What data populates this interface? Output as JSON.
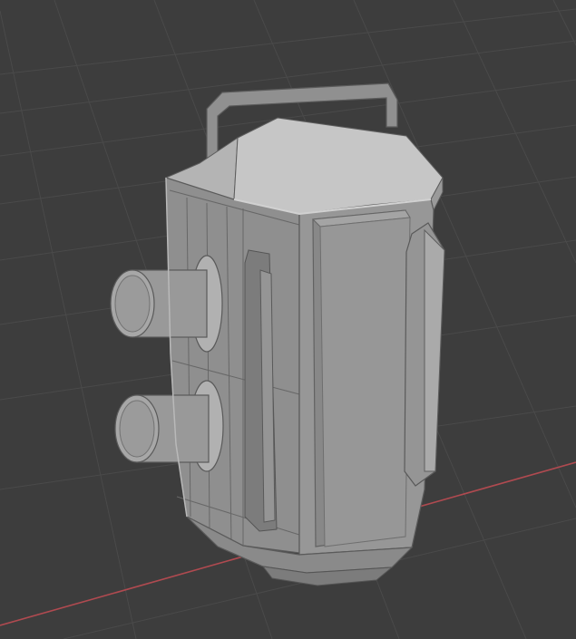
{
  "viewport": {
    "mode": "solid",
    "background_color": "#3d3d3d",
    "grid_color": "#4a4a4a",
    "x_axis_color": "#b04a50",
    "model_base_color": "#8f8f8f",
    "model_light_color": "#b7b7b7",
    "model_dark_color": "#6c6c6c",
    "wire_color": "#5b5b5b"
  },
  "scene": {
    "object": "camera-body-mesh",
    "lens_count": 2,
    "has_top_handle": true
  }
}
